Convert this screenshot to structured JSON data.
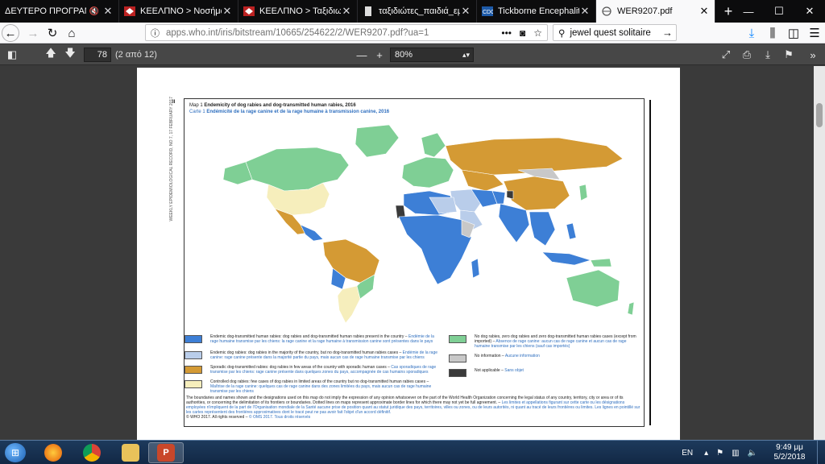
{
  "browser": {
    "tabs": [
      {
        "label": "ΔΕΥΤΕΡΟ ΠΡΟΓΡΑΜΜΑ | ΣΚΑΪ",
        "extra": "🔇",
        "active": false
      },
      {
        "label": "ΚΕΕΛΠΝΟ > Νοσήματα Α",
        "extra": "",
        "active": false
      },
      {
        "label": "ΚΕΕΛΠΝΟ > Ταξιδιωτική",
        "extra": "",
        "active": false
      },
      {
        "label": "ταξιδιώτες_παιδιά_εμβόλια",
        "extra": "",
        "active": false
      },
      {
        "label": "Tickborne Encephalitis - C",
        "extra": "",
        "active": false
      },
      {
        "label": "WER9207.pdf",
        "extra": "",
        "active": true
      }
    ],
    "url": {
      "host": "apps.who.int",
      "path": "/iris/bitstream/10665/254622/2/WER9207.pdf?ua=1"
    },
    "search_value": "jewel quest solitaire"
  },
  "pdf": {
    "page_number": "78",
    "page_count": "(2 από 12)",
    "zoom": "80%",
    "page_mark": "II",
    "side_text": "WEEKLY EPIDEMIOLOGICAL RECORD, NO 7, 17 FEBRUARY 2017",
    "map_title_prefix": "Map 1",
    "map_title": "Endemicity of dog rabies and dog-transmitted human rabies, 2016",
    "map_title_fr_prefix": "Carte 1",
    "map_title_fr": "Endémicité de la rage canine et de la rage humaine à transmission canine, 2016",
    "legend": [
      {
        "en": "Endemic dog-transmitted human rabies: dog rabies and dog-transmitted human rabies present in the country –",
        "fr": "Endémie de la rage humaine transmise par les chiens: la rage canine et la rage humaine à transmission canine sont présentes dans le pays"
      },
      {
        "en": "Endemic dog rabies: dog rabies in the majority of the country, but no dog-transmitted human rabies cases –",
        "fr": "Endémie de la rage canine: rage canine présente dans la majorité partie du pays, mais aucun cas de rage humaine transmise par les chiens"
      },
      {
        "en": "Sporadic dog-transmitted rabies: dog rabies in few areas of the country with sporadic human cases –",
        "fr": "Cas sporadiques de rage transmise par les chiens: rage canine présente dans quelques zones du pays, accompagnée de cas humains sporadiques"
      },
      {
        "en": "Controlled dog rabies: few cases of dog rabies in limited areas of the country but no dog-transmitted human rabies cases –",
        "fr": "Maîtrise de la rage canine: quelques cas de rage canine dans des zones limitées du pays, mais aucun cas de rage humaine transmise par les chiens"
      },
      {
        "en": "No dog rabies, zero dog rabies and zero dog-transmitted human rabies cases (except from imported) –",
        "fr": "Absence de rage canine: aucun cas de rage canine et aucun cas de rage humaine transmise par les chiens (sauf cas importés)"
      },
      {
        "en": "No information –",
        "fr": "Aucune information"
      },
      {
        "en": "Not applicable –",
        "fr": "Sans objet"
      }
    ],
    "disclaimer_en": "The boundaries and names shown and the designations used on this map do not imply the expression of any opinion whatsoever on the part of the World Health Organization concerning the legal status of any country, territory, city or area or of its authorities, or concerning the delimitation of its frontiers or boundaries. Dotted lines on maps represent approximate border lines for which there may not yet be full agreement. –",
    "disclaimer_fr": "Les limites et appellations figurant sur cette carte ou les désignations employées n'impliquent de la part de l'Organisation mondiale de la Santé aucune prise de position quant au statut juridique des pays, territoires, villes ou zones, ou de leurs autorités, ni quant au tracé de leurs frontières ou limites. Les lignes en pointillé sur les cartes représentent des frontières approximatives dont le tracé peut ne pas avoir fait l'objet d'un accord définitif.",
    "copyright_en": "© WHO 2017. All rights reserved –",
    "copyright_fr": "© OMS 2017. Tous droits réservés"
  },
  "colors": {
    "endemic_human": "#3d7fd6",
    "endemic_dog": "#b9cdea",
    "sporadic": "#d49a34",
    "controlled": "#f6eebc",
    "no_rabies": "#7fcf95",
    "no_info": "#c8c8c8",
    "not_applicable": "#3a3a3a"
  },
  "taskbar": {
    "language": "EN",
    "time": "9:49 μμ",
    "date": "5/2/2018"
  }
}
